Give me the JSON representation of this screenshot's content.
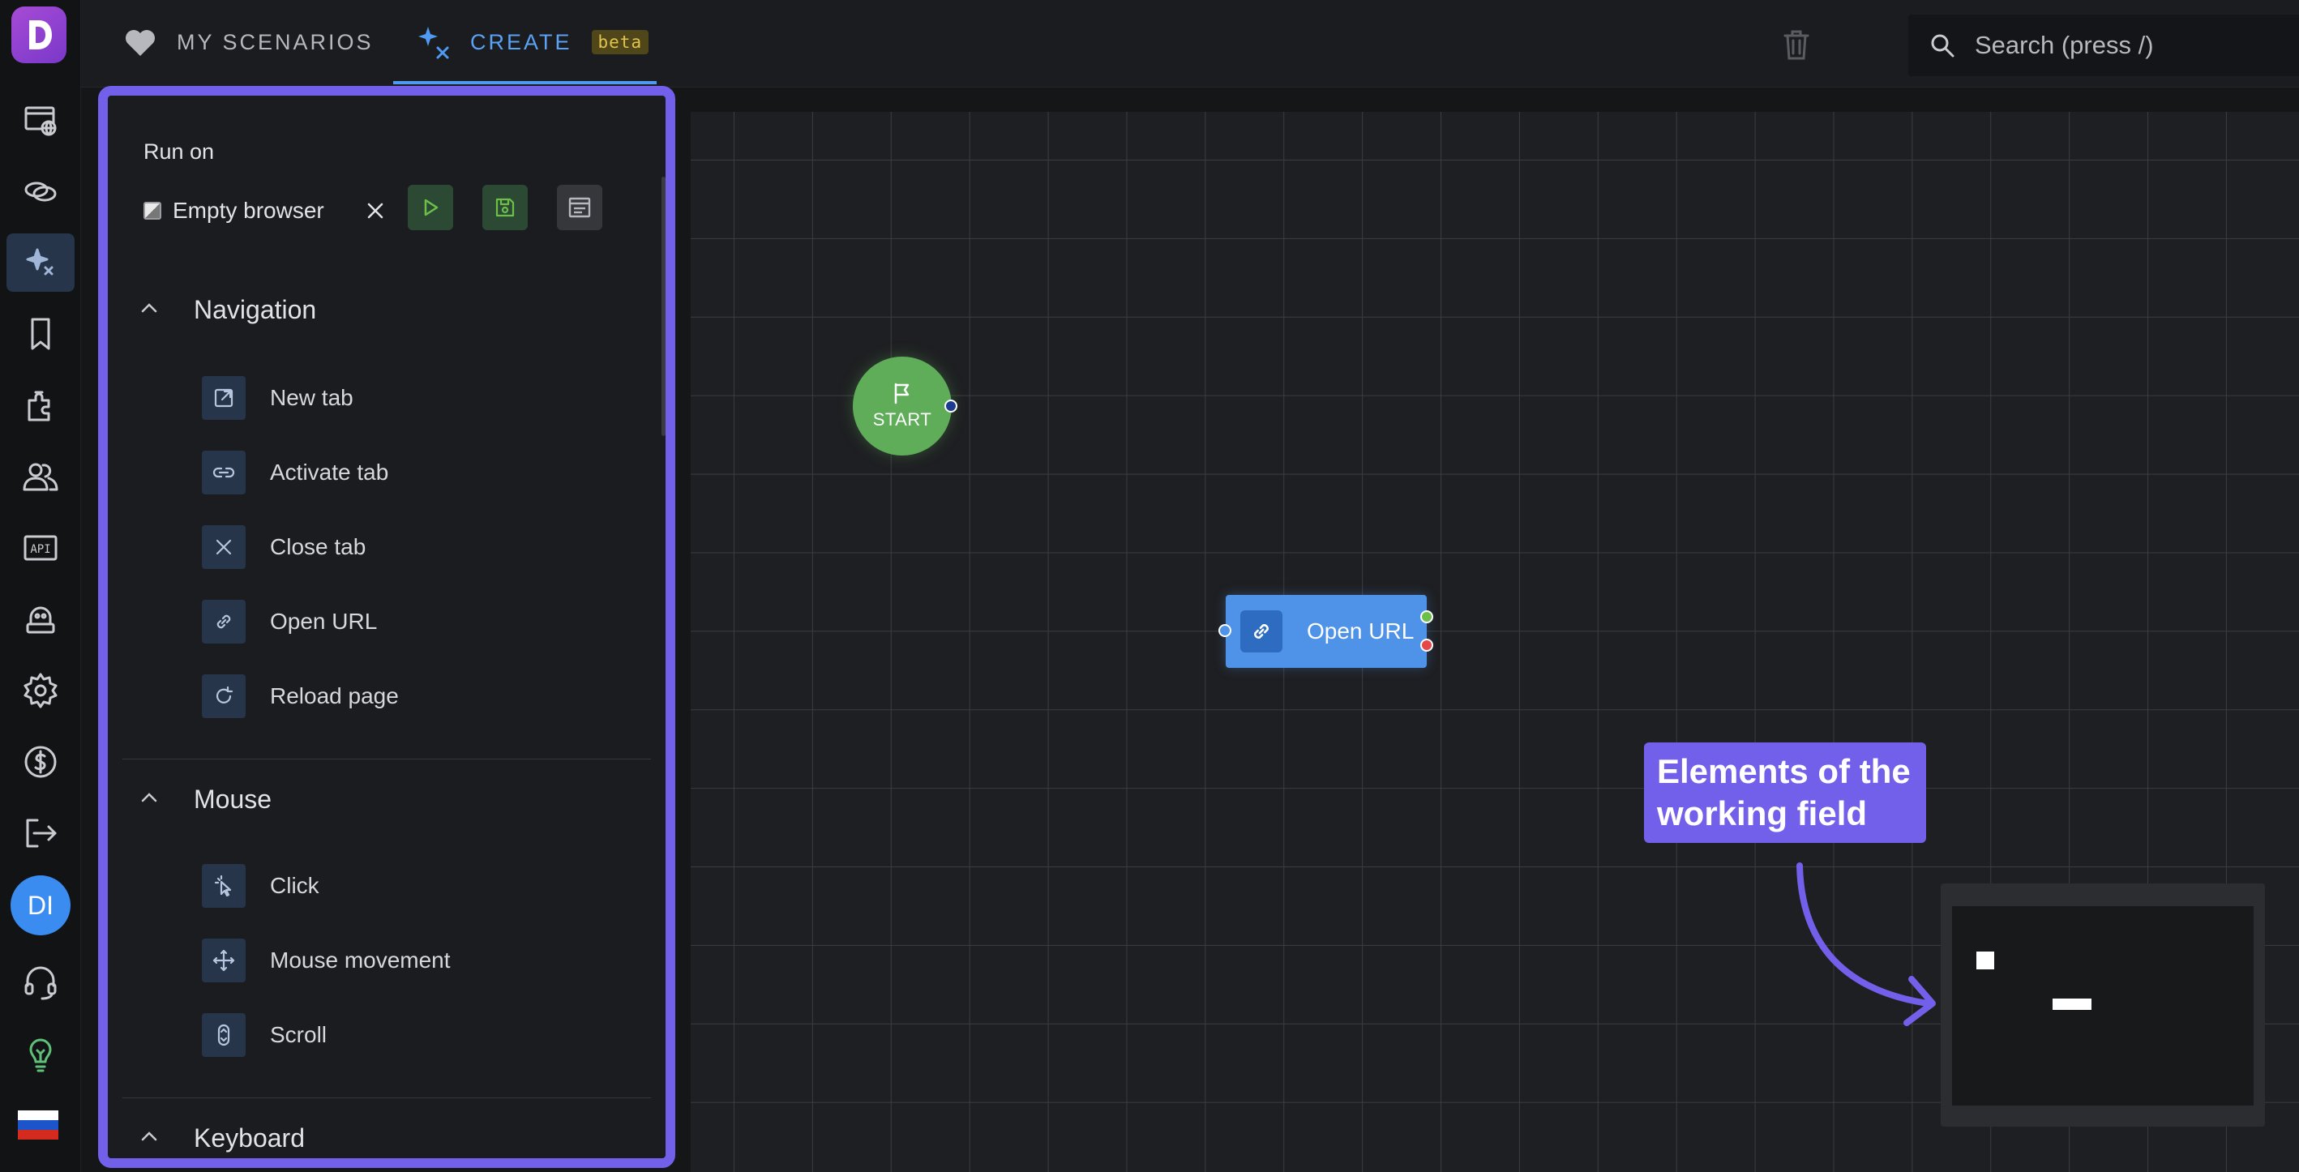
{
  "tabs": {
    "my_scenarios": "MY SCENARIOS",
    "create": "CREATE",
    "beta": "beta"
  },
  "search": {
    "placeholder": "Search (press /)"
  },
  "rail": {
    "avatar_initials": "DI",
    "api_label": "API",
    "active_item": "create"
  },
  "panel": {
    "run_on_label": "Run on",
    "browser_label": "Empty browser",
    "sections": [
      {
        "title": "Navigation",
        "items": [
          {
            "label": "New tab",
            "icon": "external-link-icon"
          },
          {
            "label": "Activate tab",
            "icon": "link-icon"
          },
          {
            "label": "Close tab",
            "icon": "close-icon"
          },
          {
            "label": "Open URL",
            "icon": "chain-link-icon"
          },
          {
            "label": "Reload page",
            "icon": "reload-icon"
          }
        ]
      },
      {
        "title": "Mouse",
        "items": [
          {
            "label": "Click",
            "icon": "cursor-click-icon"
          },
          {
            "label": "Mouse movement",
            "icon": "move-arrows-icon"
          },
          {
            "label": "Scroll",
            "icon": "scroll-icon"
          }
        ]
      },
      {
        "title": "Keyboard",
        "items": []
      }
    ]
  },
  "canvas": {
    "start_label": "START",
    "node_label": "Open URL"
  },
  "annotation": {
    "text": "Elements of the working field"
  },
  "colors": {
    "accent": "#7360ea",
    "tab_active": "#4f9bf3",
    "start_node": "#5fad59",
    "url_node": "#4e93e8",
    "port_success": "#6cc04a",
    "port_error": "#e54848"
  }
}
